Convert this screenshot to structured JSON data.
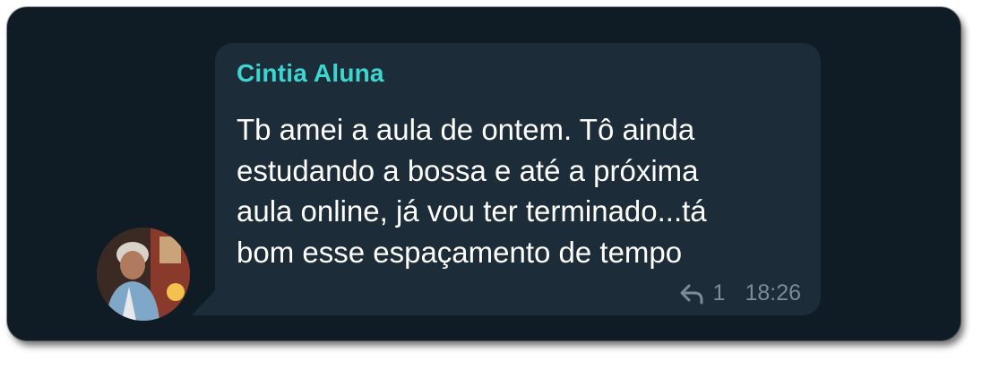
{
  "message": {
    "sender_name": "Cintia Aluna",
    "text": "Tb amei a aula de ontem. Tô ainda\nestudando a bossa e até a próxima\naula online, já vou ter terminado...tá\nbom esse espaçamento de tempo",
    "reply_count": "1",
    "time": "18:26"
  },
  "colors": {
    "background": "#0f1c26",
    "bubble": "#1c2c38",
    "sender_name": "#3bd6d0",
    "meta_text": "#7c8b97"
  },
  "icons": {
    "reply": "reply-arrow-icon"
  }
}
